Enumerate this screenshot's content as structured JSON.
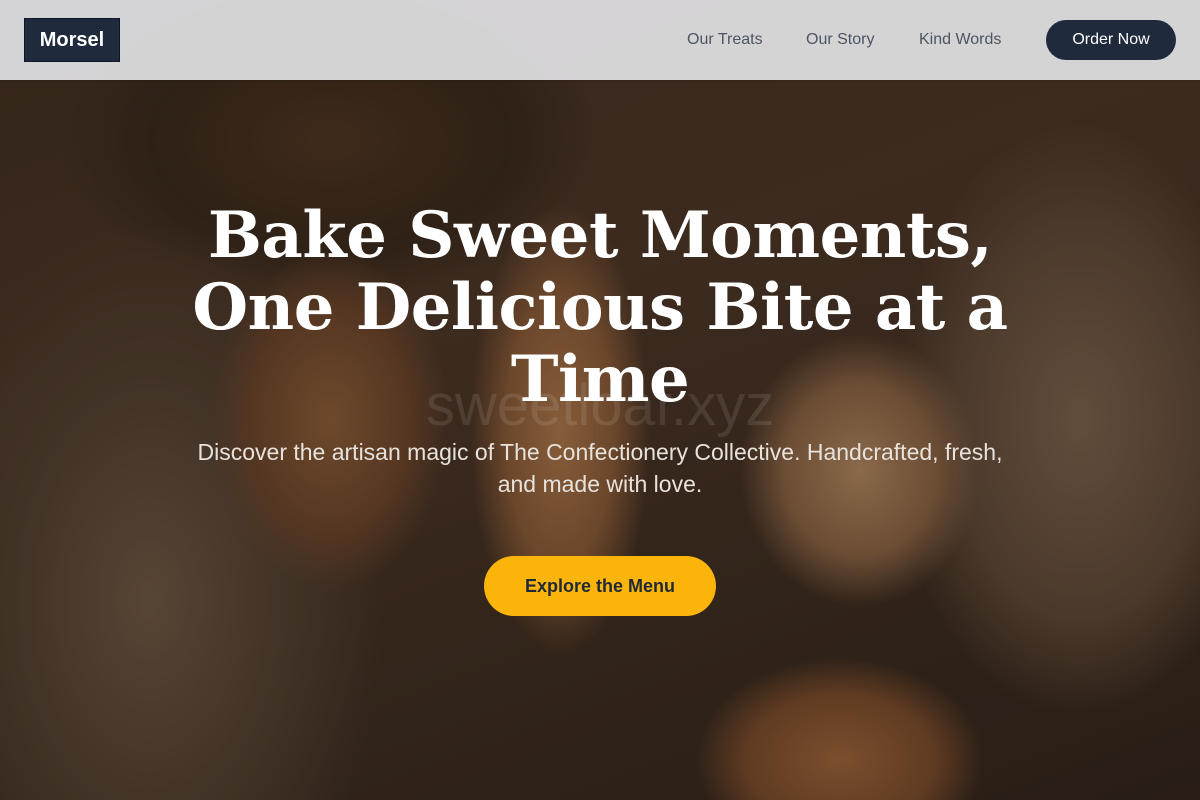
{
  "header": {
    "logo_text": "Morsel",
    "nav": [
      {
        "label": "Our Treats"
      },
      {
        "label": "Our Story"
      },
      {
        "label": "Kind Words"
      }
    ],
    "order_label": "Order Now"
  },
  "hero": {
    "title": "Bake Sweet Moments, One Delicious Bite at a Time",
    "subtitle": "Discover the artisan magic of The Confectionery Collective. Handcrafted, fresh, and made with love.",
    "cta_label": "Explore the Menu",
    "watermark": "sweetloaf.xyz",
    "background_image": "bread-loaves-photo"
  },
  "colors": {
    "brand_dark": "#1f2a3c",
    "accent_yellow": "#fbb40a",
    "nav_background": "#e1e1e3"
  }
}
